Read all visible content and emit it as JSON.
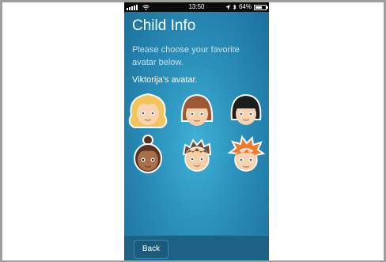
{
  "status_bar": {
    "time": "13:50",
    "battery": "64%",
    "signal_icon": "signal-bars-icon",
    "wifi_icon": "wifi-icon",
    "location_icon": "location-arrow-icon",
    "bluetooth_icon": "bluetooth-icon",
    "battery_level": 0.64
  },
  "screen": {
    "title": "Child Info",
    "subtitle": "Please choose your favorite avatar below.",
    "avatar_label": "Viktorija's avatar."
  },
  "avatars": [
    {
      "name": "blonde-curly-girl",
      "hair": "blonde"
    },
    {
      "name": "brown-hair-girl",
      "hair": "brown"
    },
    {
      "name": "black-bob-girl",
      "hair": "black"
    },
    {
      "name": "bun-hair-girl",
      "hair": "dark-brown"
    },
    {
      "name": "spiky-brown-boy",
      "hair": "brown"
    },
    {
      "name": "spiky-orange-boy",
      "hair": "orange"
    }
  ],
  "colors": {
    "background_top": "#3fb0d4",
    "background_bottom": "#1c6e9b",
    "bottom_bar": "#1e6186"
  },
  "footer": {
    "back_label": "Back"
  }
}
